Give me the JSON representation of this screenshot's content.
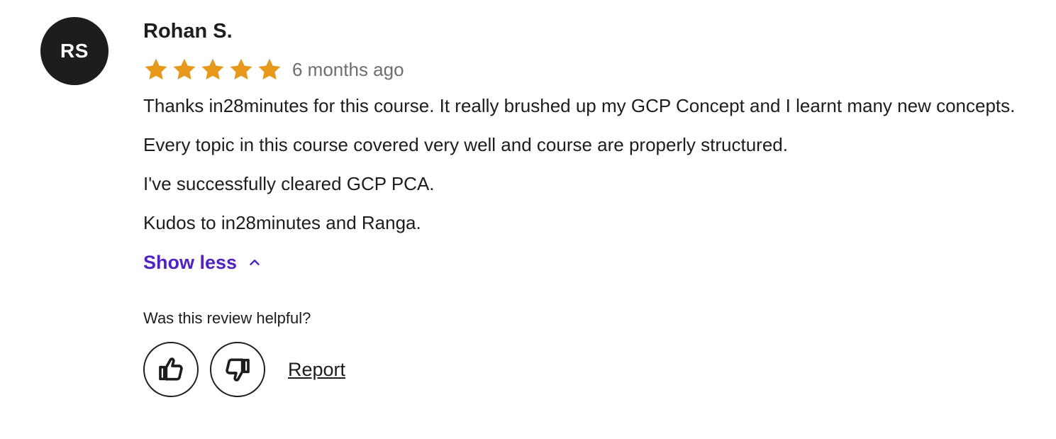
{
  "reviewer": {
    "initials": "RS",
    "name": "Rohan S."
  },
  "rating": {
    "value": 5,
    "max": 5,
    "color": "#e59819"
  },
  "time_ago": "6 months ago",
  "review_paragraphs": [
    "Thanks in28minutes for this course. It really brushed up my GCP Concept and I learnt many new concepts.",
    "Every topic in this course covered very well and course are properly structured.",
    "I've successfully cleared GCP PCA.",
    "Kudos to in28minutes and Ranga."
  ],
  "toggle": {
    "label": "Show less",
    "icon": "chevron-up-icon",
    "color": "#5022c3"
  },
  "helpful": {
    "question": "Was this review helpful?",
    "thumbs_up_icon": "thumbs-up-icon",
    "thumbs_down_icon": "thumbs-down-icon",
    "report_label": "Report"
  }
}
